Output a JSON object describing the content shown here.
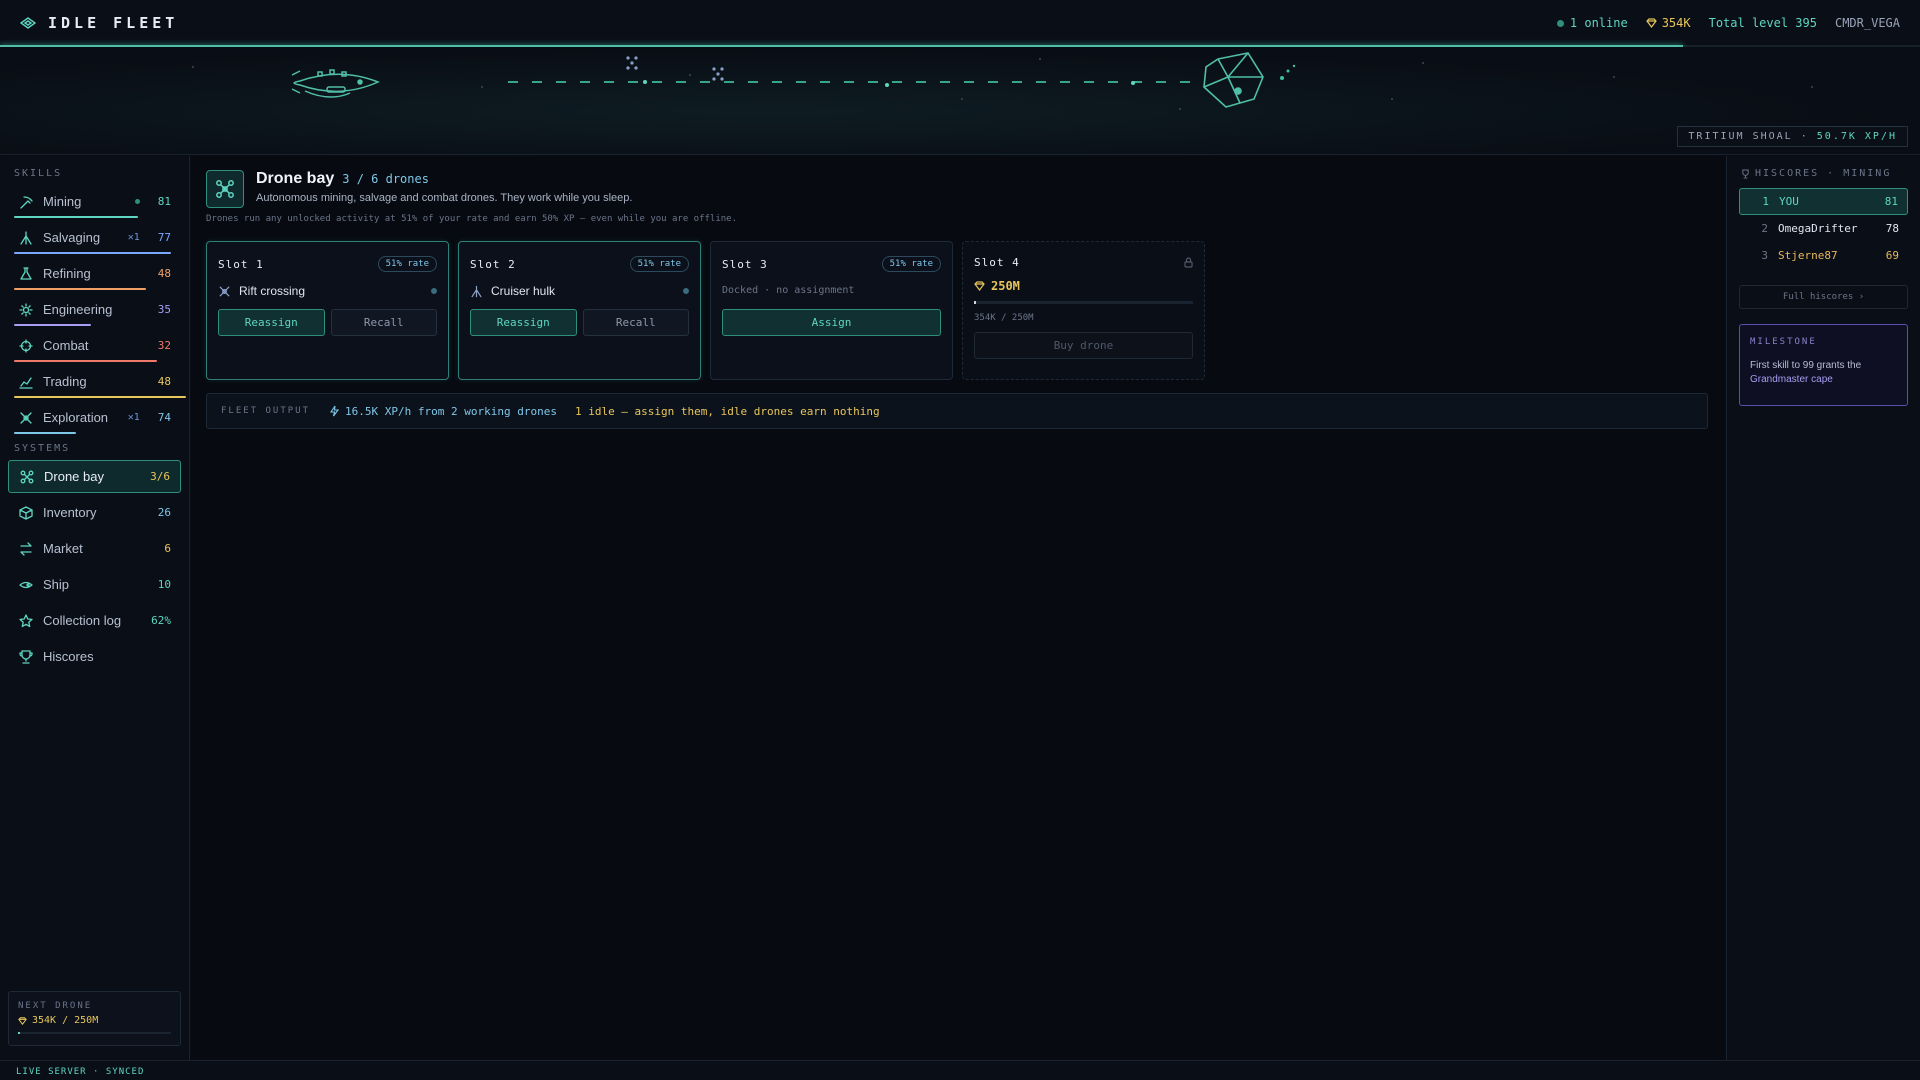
{
  "brand": {
    "title": "IDLE FLEET"
  },
  "topbar": {
    "online": "1 online",
    "credits": "354K",
    "total_level": "Total level 395",
    "user": "CMDR_VEGA"
  },
  "banner": {
    "location": "TRITIUM SHOAL",
    "separator": "·",
    "xp_rate": "50.7K XP/H"
  },
  "sidebar": {
    "skills_title": "SKILLS",
    "skills": [
      {
        "label": "Mining",
        "level": "81",
        "mult": "",
        "color": "#5fd6c2",
        "icon": "pickaxe-icon",
        "progress": 0.72,
        "has_dot": true
      },
      {
        "label": "Salvaging",
        "level": "77",
        "mult": "✕1",
        "color": "#7aa7ff",
        "icon": "salvage-icon",
        "progress": 0.91
      },
      {
        "label": "Refining",
        "level": "48",
        "mult": "",
        "color": "#f0a067",
        "icon": "flask-icon",
        "progress": 0.77
      },
      {
        "label": "Engineering",
        "level": "35",
        "mult": "",
        "color": "#a99cf2",
        "icon": "gear-icon",
        "progress": 0.45
      },
      {
        "label": "Combat",
        "level": "32",
        "mult": "",
        "color": "#f07a6a",
        "icon": "crosshair-icon",
        "progress": 0.83
      },
      {
        "label": "Trading",
        "level": "48",
        "mult": "",
        "color": "#e8c65b",
        "icon": "chart-icon",
        "progress": 1.0
      },
      {
        "label": "Exploration",
        "level": "74",
        "mult": "✕1",
        "color": "#7fc7e8",
        "icon": "compass-icon",
        "progress": 0.36
      }
    ],
    "systems_title": "SYSTEMS",
    "systems": [
      {
        "label": "Drone bay",
        "value": "3/6",
        "color": "#e8c65b",
        "icon": "drone-icon",
        "active": true
      },
      {
        "label": "Inventory",
        "value": "26",
        "color": "#7fc7e8",
        "icon": "cube-icon"
      },
      {
        "label": "Market",
        "value": "6",
        "color": "#e8c65b",
        "icon": "swap-icon"
      },
      {
        "label": "Ship",
        "value": "10",
        "color": "#5fd6c2",
        "icon": "ship-icon"
      },
      {
        "label": "Collection log",
        "value": "62%",
        "color": "#5fd6c2",
        "icon": "star-icon"
      },
      {
        "label": "Hiscores",
        "value": "",
        "color": "#5fd6c2",
        "icon": "trophy-icon"
      }
    ],
    "next_drone": {
      "title": "NEXT DRONE",
      "value": "354K / 250M",
      "progress": 0.0014
    }
  },
  "main": {
    "title": "Drone bay",
    "count": "3 / 6 drones",
    "subtitle": "Autonomous mining, salvage and combat drones. They work while you sleep.",
    "note": "Drones run any unlocked activity at 51% of your rate and earn 50% XP — even while you are offline.",
    "slots": [
      {
        "name": "Slot 1",
        "rate": "51% rate",
        "activity": "Rift crossing",
        "reassign": "Reassign",
        "recall": "Recall"
      },
      {
        "name": "Slot 2",
        "rate": "51% rate",
        "activity": "Cruiser hulk",
        "reassign": "Reassign",
        "recall": "Recall"
      },
      {
        "name": "Slot 3",
        "rate": "51% rate",
        "status": "Docked · no assignment",
        "assign": "Assign"
      },
      {
        "name": "Slot 4",
        "price": "250M",
        "progress_label": "354K / 250M",
        "buy": "Buy drone",
        "progress": 0.0014
      }
    ],
    "output": {
      "label": "FLEET OUTPUT",
      "xp": "16.5K XP/h from 2 working drones",
      "warning": "1 idle — assign them, idle drones earn nothing"
    }
  },
  "hiscores": {
    "title": "HISCORES · MINING",
    "rows": [
      {
        "rank": "1",
        "name": "YOU",
        "score": "81"
      },
      {
        "rank": "2",
        "name": "OmegaDrifter",
        "score": "78"
      },
      {
        "rank": "3",
        "name": "Stjerne87",
        "score": "69"
      }
    ],
    "full_link": "Full hiscores ›",
    "milestone": {
      "title": "MILESTONE",
      "text_a": "First skill to 99 grants the",
      "text_b": "Grandmaster cape"
    }
  },
  "status": {
    "text": "LIVE SERVER · SYNCED"
  }
}
